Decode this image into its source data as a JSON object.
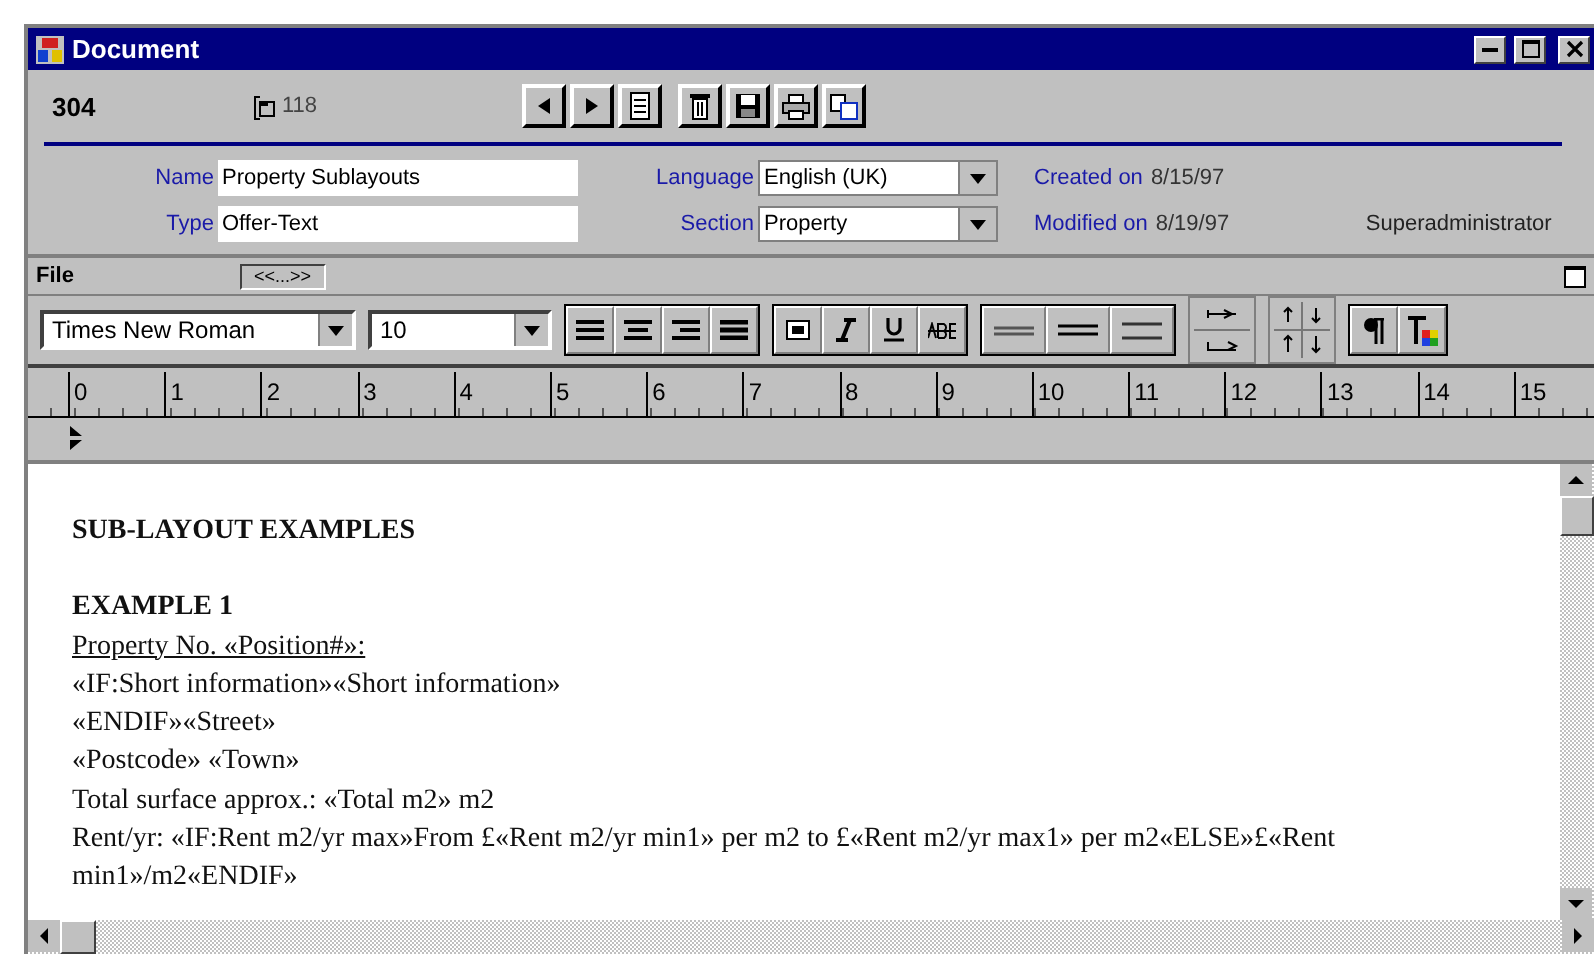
{
  "window": {
    "title": "Document"
  },
  "record": {
    "number": "304",
    "attachments": "118"
  },
  "form": {
    "name_label": "Name",
    "name": "Property Sublayouts",
    "type_label": "Type",
    "type": "Offer-Text",
    "language_label": "Language",
    "language": "English (UK)",
    "section_label": "Section",
    "section": "Property",
    "created_label": "Created on",
    "created": "8/15/97",
    "modified_label": "Modified on",
    "modified": "8/19/97",
    "user": "Superadministrator"
  },
  "menu": {
    "file": "File",
    "toggle": "<<...>>"
  },
  "format": {
    "font": "Times New Roman",
    "size": "10"
  },
  "ruler": [
    "0",
    "1",
    "2",
    "3",
    "4",
    "5",
    "6",
    "7",
    "8",
    "9",
    "10",
    "11",
    "12",
    "13",
    "14",
    "15"
  ],
  "document": [
    {
      "kind": "heading",
      "text": "SUB-LAYOUT EXAMPLES"
    },
    {
      "kind": "heading",
      "text": "EXAMPLE 1"
    },
    {
      "kind": "underline",
      "text": "Property No. «Position#»:"
    },
    {
      "kind": "plain",
      "text": "«IF:Short information»«Short information»"
    },
    {
      "kind": "plain",
      "text": "«ENDIF»«Street»"
    },
    {
      "kind": "plain",
      "text": "«Postcode» «Town»"
    },
    {
      "kind": "plain",
      "text": "Total surface approx.: «Total m2» m2"
    },
    {
      "kind": "plain",
      "text": "Rent/yr: «IF:Rent m2/yr max»From £«Rent m2/yr min1» per m2 to £«Rent m2/yr max1» per m2«ELSE»£«Rent min1»/m2«ENDIF»"
    }
  ]
}
